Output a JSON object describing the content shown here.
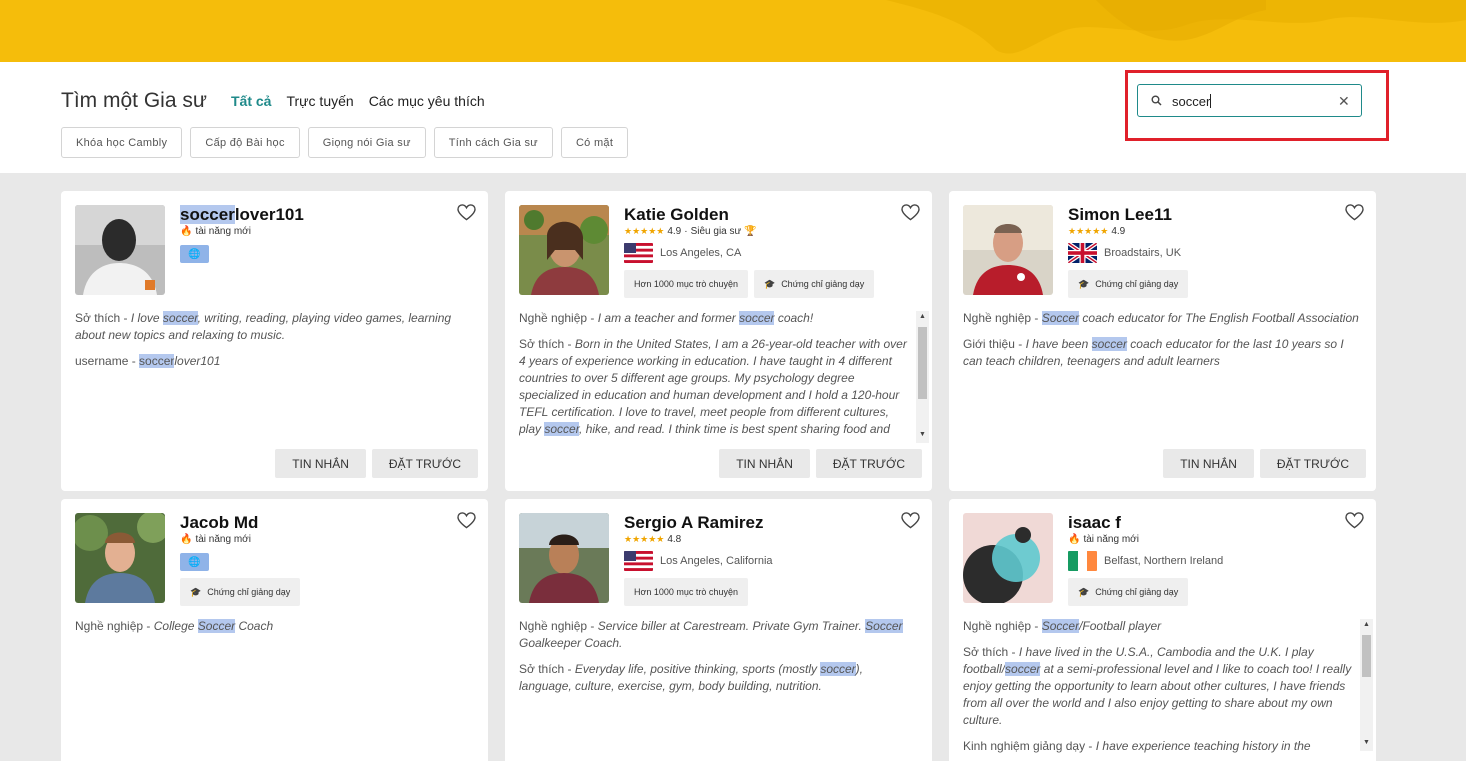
{
  "header": {
    "title": "Tìm một Gia sư",
    "tabs": [
      "Tất cả",
      "Trực tuyến",
      "Các mục yêu thích"
    ],
    "filters": [
      "Khóa học Cambly",
      "Cấp độ Bài học",
      "Giọng nói Gia sư",
      "Tính cách Gia sư",
      "Có mặt"
    ],
    "search_value": "soccer"
  },
  "labels": {
    "message": "TIN NHẮN",
    "book": "ĐẶT TRƯỚC",
    "new_talent": "tài năng mới",
    "chats": "Hơn 1000 mục trò chuyện",
    "cert": "Chứng chỉ giảng dạy",
    "super": "Siêu gia sư"
  },
  "tutors": [
    {
      "name_hl": "soccer",
      "name_rest": "lover101",
      "hobby_label": "Sở thích - ",
      "hobby_a": "I love ",
      "hobby_hl": "soccer",
      "hobby_b": ", writing, reading, playing video games, learning about new topics and relaxing to music.",
      "user_label": "username - ",
      "user_hl": "soccer",
      "user_rest": "lover101"
    },
    {
      "name": "Katie Golden",
      "rating": "4.9",
      "location": "Los Angeles, CA",
      "job_label": "Nghề nghiệp - ",
      "job_a": "I am a teacher and former ",
      "job_hl": "soccer",
      "job_b": " coach!",
      "hobby_label": "Sở thích - ",
      "hobby_a": "Born in the United States, I am a 26-year-old teacher with over 4 years of experience working in education. I have taught in 4 different countries to over 5 different age groups. My psychology degree specialized in education and human development and I hold a 120-hour TEFL certification. I love to travel, meet people from different cultures, play ",
      "hobby_hl": "soccer",
      "hobby_b": ", hike, and read. I think time is best spent sharing food and wine. I am currently learning Spanish and"
    },
    {
      "name": "Simon Lee11",
      "rating": "4.9",
      "location": "Broadstairs, UK",
      "job_label": "Nghề nghiệp - ",
      "job_hl": "Soccer",
      "job_b": " coach educator for The English Football Association",
      "intro_label": "Giới thiệu - ",
      "intro_a": "I have been ",
      "intro_hl": "soccer",
      "intro_b": " coach educator for the last 10 years so I can teach children, teenagers and adult learners"
    },
    {
      "name": "Jacob Md",
      "job_label": "Nghề nghiệp - ",
      "job_a": "College ",
      "job_hl": "Soccer",
      "job_b": " Coach"
    },
    {
      "name": "Sergio A Ramirez",
      "rating": "4.8",
      "location": "Los Angeles, California",
      "job_label": "Nghề nghiệp - ",
      "job_a": "Service biller at Carestream. Private Gym Trainer. ",
      "job_hl": "Soccer",
      "job_b": " Goalkeeper Coach.",
      "hobby_label": "Sở thích - ",
      "hobby_a": "Everyday life, positive thinking, sports (mostly ",
      "hobby_hl": "soccer",
      "hobby_b": "), language, culture, exercise, gym, body building, nutrition."
    },
    {
      "name": "isaac f",
      "location": "Belfast, Northern Ireland",
      "job_label": "Nghề nghiệp - ",
      "job_hl": "Soccer",
      "job_b": "/Football player",
      "hobby_label": "Sở thích - ",
      "hobby_a": "I have lived in the U.S.A., Cambodia and the U.K. I play football/",
      "hobby_hl": "soccer",
      "hobby_b": " at a semi-professional level and I like to coach too! I really enjoy getting the opportunity to learn about other cultures, I have friends from all over the world and I also enjoy getting to share about my own culture.",
      "exp_label": "Kinh nghiệm giảng dạy - ",
      "exp_a": "I have experience teaching history in the"
    }
  ],
  "icons": [
    "search-icon",
    "close-icon",
    "heart-icon",
    "fire-icon",
    "trophy-icon",
    "graduation-cap-icon",
    "globe-icon",
    "star-icon"
  ],
  "colors": {
    "banner": "#f5bd0b",
    "accent": "#1f8a8a",
    "highlight": "#b4c8ee",
    "outline": "#e0202a",
    "star": "#f0a500"
  }
}
